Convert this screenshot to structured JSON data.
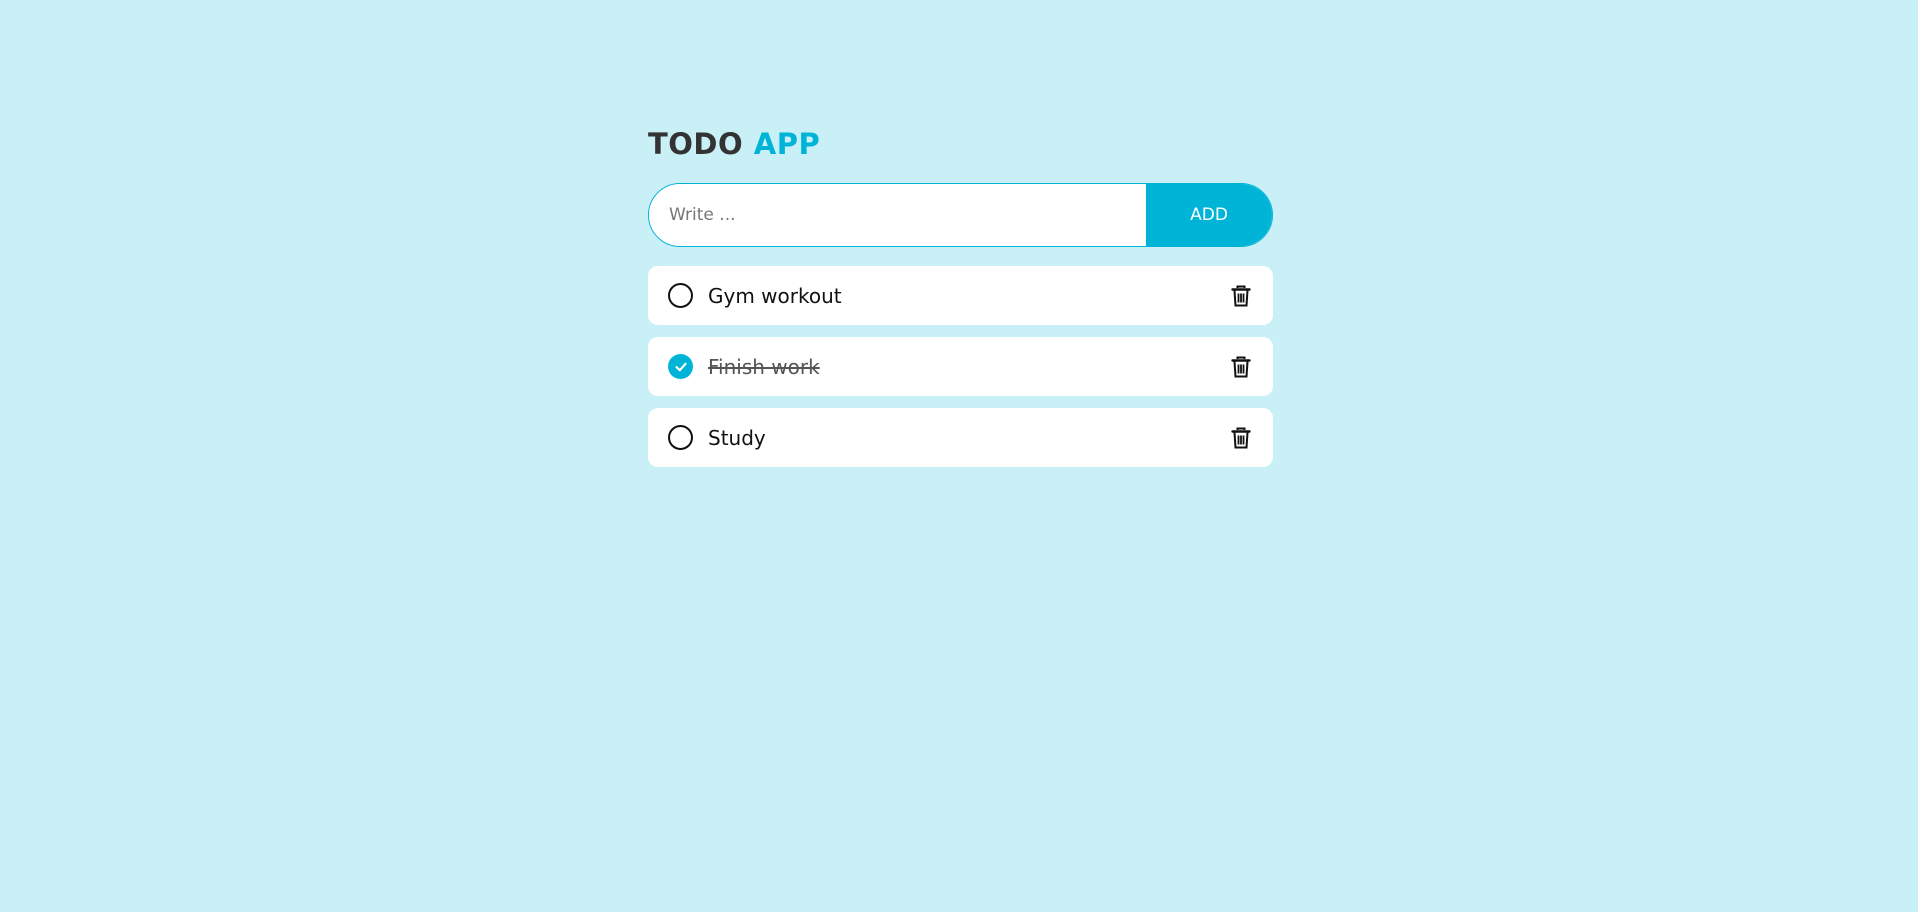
{
  "header": {
    "title_main": "TODO",
    "title_accent": "APP"
  },
  "input": {
    "placeholder": "Write ...",
    "value": ""
  },
  "add_button": {
    "label": "ADD"
  },
  "todos": [
    {
      "text": "Gym workout",
      "done": false
    },
    {
      "text": "Finish work",
      "done": true
    },
    {
      "text": "Study",
      "done": false
    }
  ],
  "colors": {
    "background": "#c9f0f7",
    "accent": "#00b4d8",
    "card": "#ffffff",
    "text": "#111111",
    "title": "#333333"
  },
  "icons": {
    "unchecked": "circle-outline-icon",
    "checked": "check-circle-icon",
    "delete": "trash-icon"
  }
}
